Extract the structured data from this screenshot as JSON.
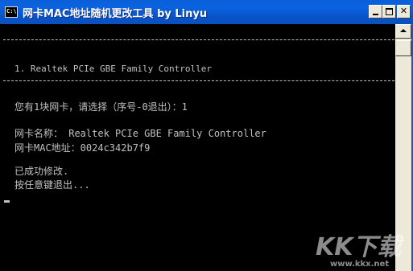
{
  "window": {
    "title": "网卡MAC地址随机更改工具 by Linyu",
    "icon_text": "C:\\",
    "icon": "console-app-icon",
    "buttons": {
      "minimize": "minimize-icon",
      "maximize": "maximize-icon",
      "close": "✕"
    }
  },
  "console": {
    "adapter_list": "1. Realtek PCIe GBE Family Controller",
    "prompt": "您有1块网卡，请选择（序号-0退出）：1",
    "nic_name": "网卡名称： Realtek PCIe GBE Family Controller",
    "nic_mac": "网卡MAC地址：0024c342b7f9",
    "success": "已成功修改.",
    "exit_hint": "按任意键退出..."
  },
  "watermark": {
    "text": "KK下载",
    "url": "www.kkx.net"
  }
}
